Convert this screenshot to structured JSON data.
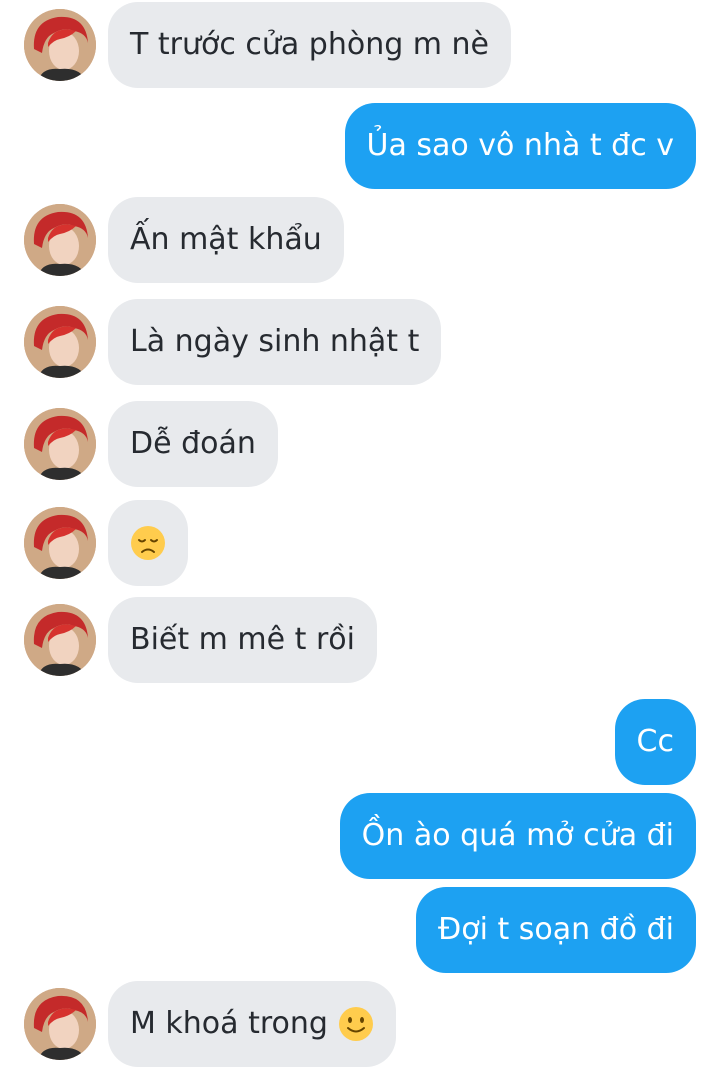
{
  "conversation": {
    "accent_color": "#1da1f2",
    "incoming_bubble_color": "#e8eaed",
    "avatar_icon": "profile-photo-red-hair",
    "messages": [
      {
        "direction": "in",
        "text": "T trước cửa phòng m nè"
      },
      {
        "direction": "out",
        "text": "Ủa sao vô nhà t đc v"
      },
      {
        "direction": "in",
        "text": "Ấn mật khẩu"
      },
      {
        "direction": "in",
        "text": "Là ngày sinh nhật t"
      },
      {
        "direction": "in",
        "text": "Dễ đoán"
      },
      {
        "direction": "in",
        "text": "",
        "emoji": "disappointed-face-emoji"
      },
      {
        "direction": "in",
        "text": "Biết m mê t rồi"
      },
      {
        "direction": "out",
        "text": "Cc"
      },
      {
        "direction": "out",
        "text": "Ồn ào quá mở cửa đi"
      },
      {
        "direction": "out",
        "text": "Đợi t soạn đồ đi"
      },
      {
        "direction": "in",
        "text": "M khoá trong",
        "emoji": "slightly-smiling-face-emoji"
      }
    ]
  }
}
